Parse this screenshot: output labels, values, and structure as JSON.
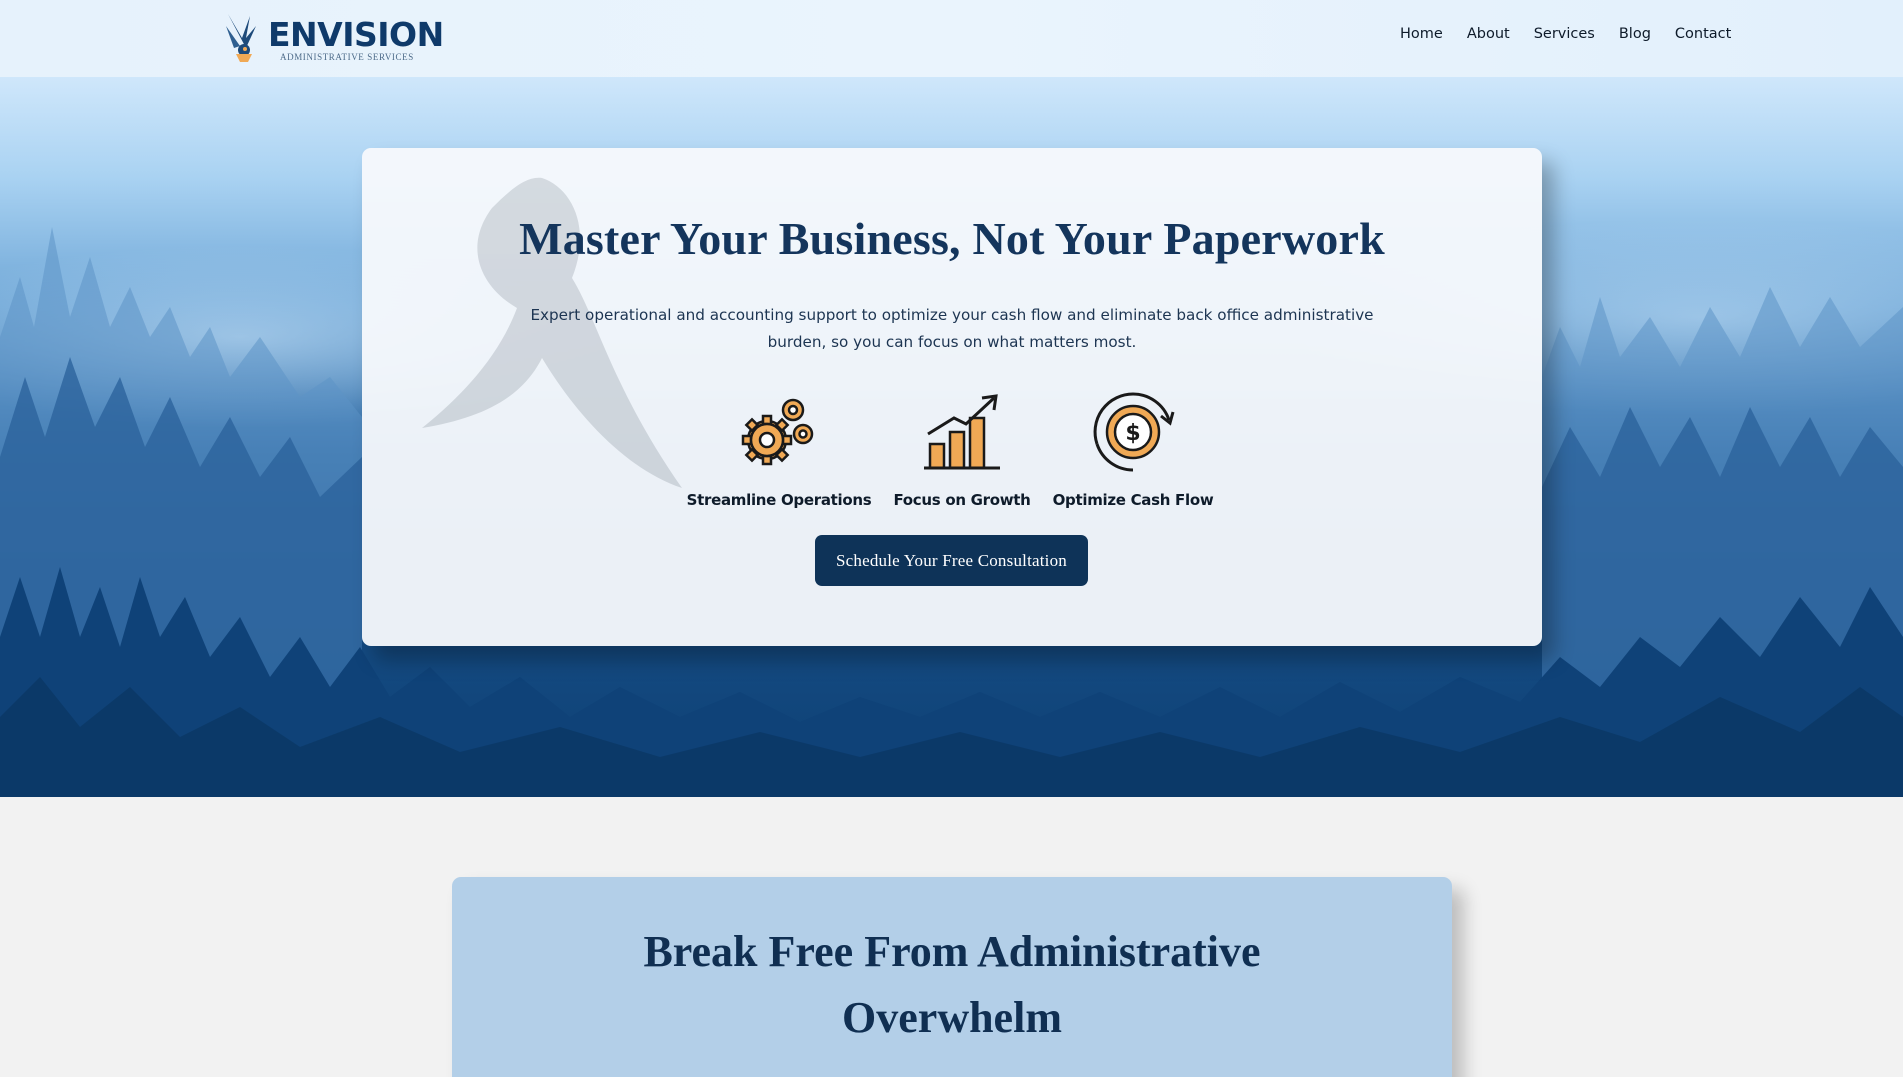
{
  "header": {
    "logo": {
      "wordmark": "ENVISION",
      "tagline": "ADMINISTRATIVE SERVICES"
    },
    "nav": [
      "Home",
      "About",
      "Services",
      "Blog",
      "Contact"
    ]
  },
  "hero": {
    "title": "Master Your Business, Not Your Paperwork",
    "subtitle": "Expert operational and accounting support to optimize your cash flow and eliminate back office administrative burden, so you can focus on what matters most.",
    "features": [
      {
        "label": "Streamline Operations",
        "icon": "gears-icon"
      },
      {
        "label": "Focus on Growth",
        "icon": "growth-chart-icon"
      },
      {
        "label": "Optimize Cash Flow",
        "icon": "cash-flow-icon"
      }
    ],
    "cta_label": "Schedule Your Free Consultation"
  },
  "section2": {
    "title_line1": "Break Free From Administrative",
    "title_line2": "Overwhelm"
  },
  "colors": {
    "navy": "#0e3358",
    "title": "#14355c",
    "accent_orange": "#f0a955",
    "card_blue": "#b3cfe8"
  }
}
